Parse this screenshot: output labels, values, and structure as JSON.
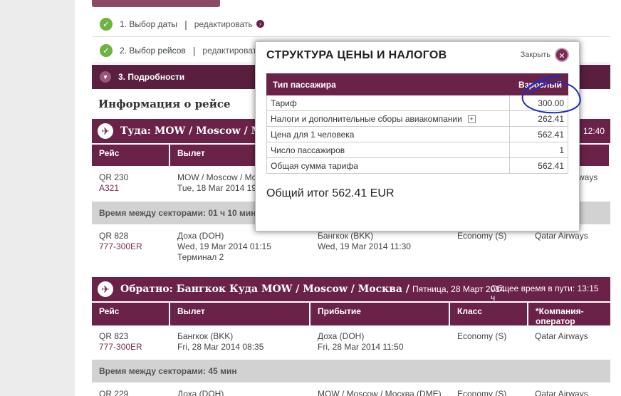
{
  "steps": [
    {
      "label": "1. Выбор даты",
      "edit": "редактировать"
    },
    {
      "label": "2. Выбор рейсов",
      "edit": "редактировать"
    },
    {
      "label": "3. Подробности"
    }
  ],
  "info_title": "Информация о рейсе",
  "outbound": {
    "title": "Туда: MOW / Moscow / M",
    "total_time": "12:40",
    "columns": [
      "Рейс",
      "Вылет"
    ],
    "flight1": {
      "number": "QR 230",
      "aircraft": "A321",
      "dep_city": "MOW / Moscow / Mo",
      "dep_time": "Tue, 18 Mar 2014 19",
      "airline": "ways"
    },
    "layover": "Время между секторами: 01 ч 10 мин",
    "flight2": {
      "number": "QR 828",
      "aircraft": "777-300ER",
      "dep_city": "Доха (DOH)",
      "dep_time": "Wed, 19 Mar 2014 01:15",
      "terminal": "Терминал 2",
      "arr_city": "Бангкок (BKK)",
      "arr_time": "Wed, 19 Mar 2014 11:30",
      "class": "Economy (S)",
      "airline": "Qatar Airways"
    }
  },
  "inbound": {
    "title": "Обратно: Бангкок  Куда MOW / Moscow / Москва /",
    "subtitle": "Пятница, 28 Март 2014",
    "total_time": "Общее время в пути: 13:15 ч",
    "columns": [
      "Рейс",
      "Вылет",
      "Прибытие",
      "Класс",
      "*Компания-оператор"
    ],
    "flight1": {
      "number": "QR 823",
      "aircraft": "777-300ER",
      "dep_city": "Бангкок (BKK)",
      "dep_time": "Fri, 28 Mar 2014 08:35",
      "arr_city": "Доха (DOH)",
      "arr_time": "Fri, 28 Mar 2014 11:50",
      "class": "Economy (S)",
      "airline": "Qatar Airways"
    },
    "layover": "Время между секторами: 45 мин",
    "flight2": {
      "number": "QR 229",
      "dep_city": "Доха (DOH)",
      "arr_city": "MOW / Moscow / Москва (DME)",
      "class": "Economy (S)",
      "airline": "Qatar Airways"
    }
  },
  "modal": {
    "title": "СТРУКТУРА ЦЕНЫ И НАЛОГОВ",
    "close_label": "Закрыть",
    "header_passenger": "Тип пассажира",
    "header_adult": "Взрослый",
    "rows": [
      {
        "label": "Тариф",
        "value": "300.00"
      },
      {
        "label": "Налоги и дополнительные сборы авиакомпании",
        "value": "262.41"
      },
      {
        "label": "Цена для 1 человека",
        "value": "562.41"
      },
      {
        "label": "Число пассажиров",
        "value": "1"
      },
      {
        "label": "Общая сумма тарифа",
        "value": "562.41"
      }
    ],
    "grand_total": "Общий итог 562.41 EUR"
  },
  "colors": {
    "accent": "#6b2249",
    "check": "#6db33f",
    "annotation": "#1a2ec2"
  }
}
